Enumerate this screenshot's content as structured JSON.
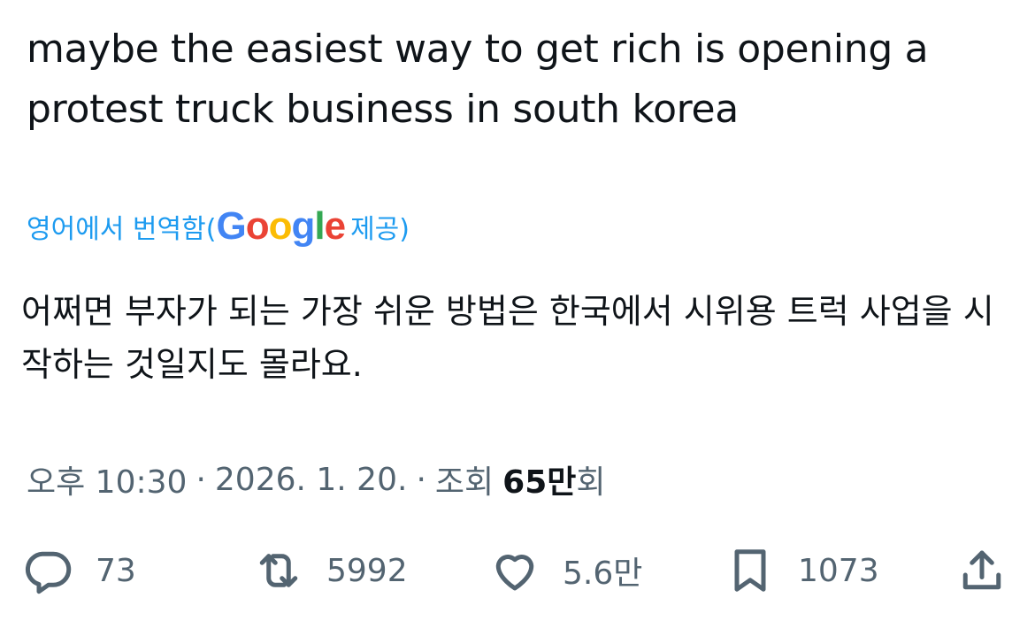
{
  "tweet": {
    "text": "maybe the easiest way to get rich is opening a protest truck business in south korea",
    "translate_prefix": "영어에서 번역함(",
    "translate_logo": {
      "G": "G",
      "o1": "o",
      "o2": "o",
      "g": "g",
      "l": "l",
      "e": "e"
    },
    "translate_suffix": "제공)",
    "translated_text": "어쩌면 부자가 되는 가장 쉬운 방법은 한국에서 시위용 트럭 사업을 시작하는 것일지도 몰라요.",
    "time": "오후 10:30",
    "separator": "·",
    "date": "2026. 1. 20.",
    "views_label": "조회",
    "views_number": "65만",
    "views_suffix": "회"
  },
  "actions": {
    "reply_count": "73",
    "retweet_count": "5992",
    "like_count": "5.6만",
    "bookmark_count": "1073"
  },
  "icons": {
    "reply": "reply-icon",
    "retweet": "retweet-icon",
    "like": "heart-icon",
    "bookmark": "bookmark-icon",
    "share": "share-icon"
  },
  "colors": {
    "text": "#0f1419",
    "secondary": "#536471",
    "link": "#1d9bf0",
    "google_blue": "#4285f4",
    "google_red": "#ea4335",
    "google_yellow": "#fbbc05",
    "google_green": "#34a853"
  }
}
